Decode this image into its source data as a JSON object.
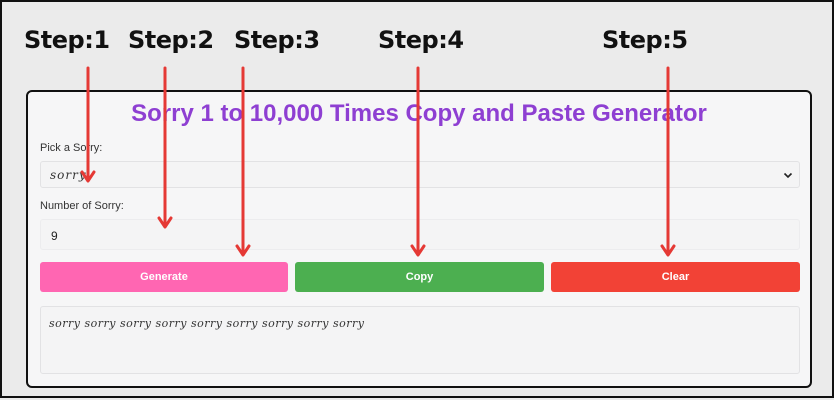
{
  "steps": [
    "Step:1",
    "Step:2",
    "Step:3",
    "Step:4",
    "Step:5"
  ],
  "card": {
    "title": "Sorry 1 to 10,000 Times Copy and Paste Generator",
    "pick_label": "Pick a Sorry:",
    "pick_value": "sorry",
    "number_label": "Number of Sorry:",
    "number_value": "9",
    "buttons": {
      "generate": "Generate",
      "copy": "Copy",
      "clear": "Clear"
    },
    "output": "sorry sorry sorry sorry sorry sorry sorry sorry sorry"
  },
  "colors": {
    "title": "#8e3fd2",
    "generate": "#ff66b2",
    "copy": "#4caf50",
    "clear": "#f24236",
    "arrow": "#e53935"
  },
  "icons": {
    "select_chevron": "chevron-down-icon",
    "step_arrow": "arrow-down-icon"
  }
}
